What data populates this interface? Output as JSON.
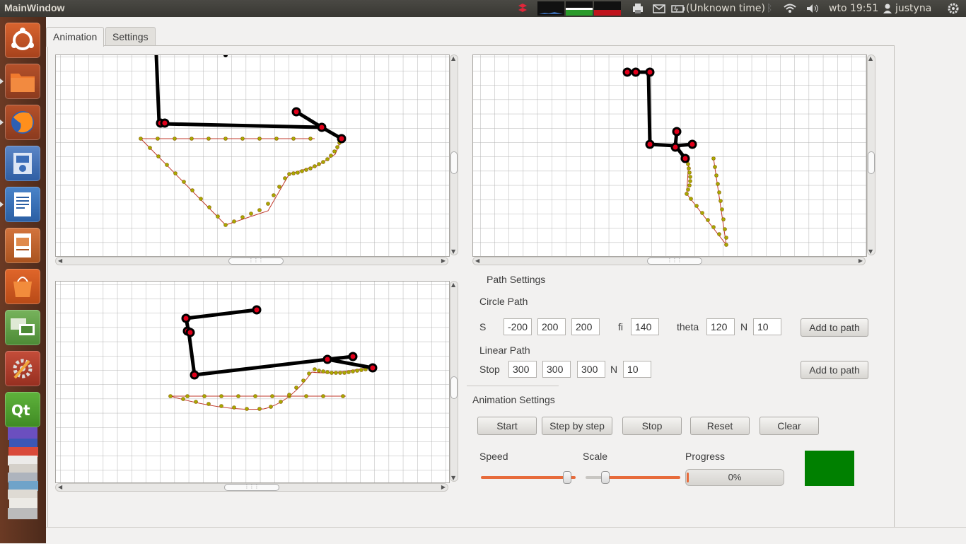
{
  "window": {
    "title": "MainWindow"
  },
  "tray": {
    "battery": "(Unknown time)",
    "clock": "wto 19:51",
    "user": "justyna"
  },
  "launcher": {
    "items": [
      "ubuntu-dash",
      "files",
      "firefox",
      "system-backup",
      "libreoffice-writer",
      "libreoffice-impress",
      "software-center",
      "remote-desktop",
      "system-settings",
      "qt-creator",
      "stacked-apps"
    ]
  },
  "tabs": [
    {
      "label": "Animation"
    },
    {
      "label": "Settings"
    }
  ],
  "path_settings": {
    "title": "Path Settings",
    "circle": {
      "title": "Circle Path",
      "s_label": "S",
      "s": [
        "-200",
        "200",
        "200"
      ],
      "fi_label": "fi",
      "fi": "140",
      "theta_label": "theta",
      "theta": "120",
      "n_label": "N",
      "n": "10",
      "add_button": "Add to path"
    },
    "linear": {
      "title": "Linear Path",
      "stop_label": "Stop",
      "stop": [
        "300",
        "300",
        "300"
      ],
      "n_label": "N",
      "n": "10",
      "add_button": "Add to path"
    }
  },
  "animation_settings": {
    "title": "Animation Settings",
    "buttons": [
      "Start",
      "Step by step",
      "Stop",
      "Reset",
      "Clear"
    ],
    "speed_label": "Speed",
    "speed_value": 0.95,
    "scale_label": "Scale",
    "scale_value": 0.18,
    "progress_label": "Progress",
    "progress_text": "0%",
    "progress_value": 0,
    "status_color": "#008000"
  },
  "colors": {
    "accent": "#e76b3b",
    "joint": "#ff0000",
    "path": "#c0392b",
    "path_point": "#a8a800"
  }
}
